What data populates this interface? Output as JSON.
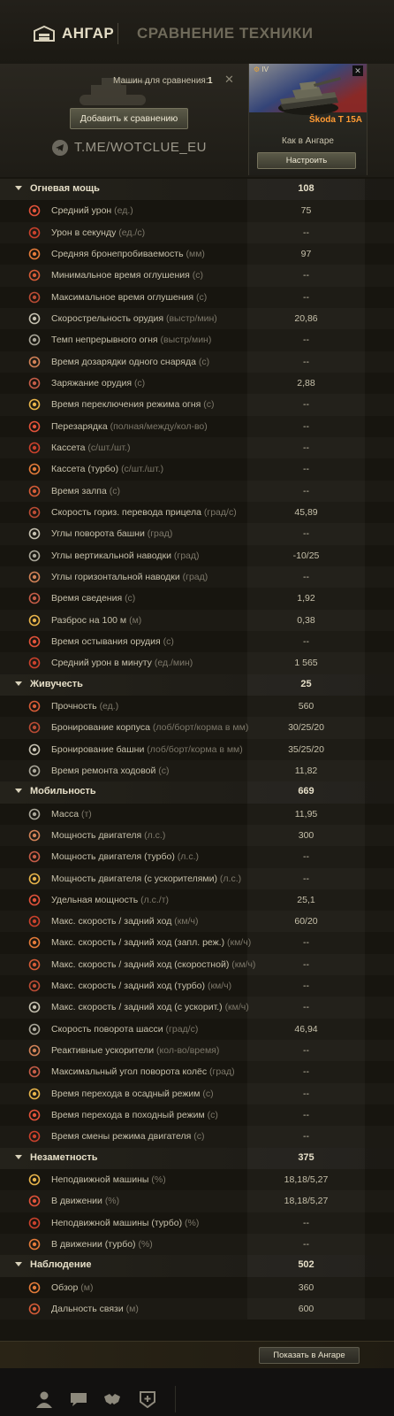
{
  "header": {
    "hangar": "АНГАР",
    "compare": "СРАВНЕНИЕ ТЕХНИКИ"
  },
  "panel": {
    "count_label": "Машин для сравнения:",
    "count_value": "1",
    "add_button": "Добавить к сравнению",
    "watermark": "T.ME/WOTCLUE_EU"
  },
  "vehicle": {
    "level": "IV",
    "name": "Škoda T 15A",
    "config": "Как в Ангаре",
    "configure_button": "Настроить"
  },
  "sections": [
    {
      "title": "Огневая мощь",
      "value": "108",
      "stats": [
        {
          "icon": "avg-damage-icon",
          "label": "Средний урон",
          "unit": "(ед.)",
          "value": "75"
        },
        {
          "icon": "damage-per-second-icon",
          "label": "Урон в секунду",
          "unit": "(ед./с)",
          "value": "--"
        },
        {
          "icon": "penetration-icon",
          "label": "Средняя бронепробиваемость",
          "unit": "(мм)",
          "value": "97"
        },
        {
          "icon": "min-stun-icon",
          "label": "Минимальное время оглушения",
          "unit": "(с)",
          "value": "--"
        },
        {
          "icon": "max-stun-icon",
          "label": "Максимальное время оглушения",
          "unit": "(с)",
          "value": "--"
        },
        {
          "icon": "rate-of-fire-icon",
          "label": "Скорострельность орудия",
          "unit": "(выстр/мин)",
          "value": "20,86"
        },
        {
          "icon": "continuous-fire-icon",
          "label": "Темп непрерывного огня",
          "unit": "(выстр/мин)",
          "value": "--"
        },
        {
          "icon": "shell-reload-icon",
          "label": "Время дозарядки одного снаряда",
          "unit": "(с)",
          "value": "--"
        },
        {
          "icon": "reload-icon",
          "label": "Заряжание орудия",
          "unit": "(с)",
          "value": "2,88"
        },
        {
          "icon": "fire-mode-switch-icon",
          "label": "Время переключения режима огня",
          "unit": "(с)",
          "value": "--"
        },
        {
          "icon": "autoreload-icon",
          "label": "Перезарядка",
          "unit": "(полная/между/кол-во)",
          "value": "--"
        },
        {
          "icon": "clip-icon",
          "label": "Кассета",
          "unit": "(с/шт./шт.)",
          "value": "--"
        },
        {
          "icon": "clip-turbo-icon",
          "label": "Кассета (турбо)",
          "unit": "(с/шт./шт.)",
          "value": "--"
        },
        {
          "icon": "salvo-icon",
          "label": "Время залпа",
          "unit": "(с)",
          "value": "--"
        },
        {
          "icon": "traverse-speed-icon",
          "label": "Скорость гориз. перевода прицела",
          "unit": "(град/с)",
          "value": "45,89"
        },
        {
          "icon": "turret-rotation-icon",
          "label": "Углы поворота башни",
          "unit": "(град)",
          "value": "--"
        },
        {
          "icon": "elevation-icon",
          "label": "Углы вертикальной наводки",
          "unit": "(град)",
          "value": "-10/25"
        },
        {
          "icon": "horizontal-aim-icon",
          "label": "Углы горизонтальной наводки",
          "unit": "(град)",
          "value": "--"
        },
        {
          "icon": "aim-time-icon",
          "label": "Время сведения",
          "unit": "(с)",
          "value": "1,92"
        },
        {
          "icon": "dispersion-icon",
          "label": "Разброс на 100 м",
          "unit": "(м)",
          "value": "0,38"
        },
        {
          "icon": "cooldown-icon",
          "label": "Время остывания орудия",
          "unit": "(с)",
          "value": "--"
        },
        {
          "icon": "damage-per-minute-icon",
          "label": "Средний урон в минуту",
          "unit": "(ед./мин)",
          "value": "1 565"
        }
      ]
    },
    {
      "title": "Живучесть",
      "value": "25",
      "stats": [
        {
          "icon": "hit-points-icon",
          "label": "Прочность",
          "unit": "(ед.)",
          "value": "560"
        },
        {
          "icon": "hull-armor-icon",
          "label": "Бронирование корпуса",
          "unit": "(лоб/борт/корма в мм)",
          "value": "30/25/20"
        },
        {
          "icon": "turret-armor-icon",
          "label": "Бронирование башни",
          "unit": "(лоб/борт/корма в мм)",
          "value": "35/25/20"
        },
        {
          "icon": "track-repair-icon",
          "label": "Время ремонта ходовой",
          "unit": "(с)",
          "value": "11,82"
        }
      ]
    },
    {
      "title": "Мобильность",
      "value": "669",
      "stats": [
        {
          "icon": "weight-icon",
          "label": "Масса",
          "unit": "(т)",
          "value": "11,95"
        },
        {
          "icon": "engine-power-icon",
          "label": "Мощность двигателя",
          "unit": "(л.с.)",
          "value": "300"
        },
        {
          "icon": "engine-turbo-icon",
          "label": "Мощность двигателя (турбо)",
          "unit": "(л.с.)",
          "value": "--"
        },
        {
          "icon": "engine-boost-icon",
          "label": "Мощность двигателя (с ускорителями)",
          "unit": "(л.с.)",
          "value": "--"
        },
        {
          "icon": "specific-power-icon",
          "label": "Удельная мощность",
          "unit": "(л.с./т)",
          "value": "25,1"
        },
        {
          "icon": "speed-icon",
          "label": "Макс. скорость / задний ход",
          "unit": "(км/ч)",
          "value": "60/20"
        },
        {
          "icon": "speed-reserve-icon",
          "label": "Макс. скорость / задний ход (запл. реж.)",
          "unit": "(км/ч)",
          "value": "--"
        },
        {
          "icon": "speed-fast-icon",
          "label": "Макс. скорость / задний ход (скоростной)",
          "unit": "(км/ч)",
          "value": "--"
        },
        {
          "icon": "speed-turbo-icon",
          "label": "Макс. скорость / задний ход (турбо)",
          "unit": "(км/ч)",
          "value": "--"
        },
        {
          "icon": "speed-boost-icon",
          "label": "Макс. скорость / задний ход (с ускорит.)",
          "unit": "(км/ч)",
          "value": "--"
        },
        {
          "icon": "hull-traverse-icon",
          "label": "Скорость поворота шасси",
          "unit": "(град/с)",
          "value": "46,94"
        },
        {
          "icon": "rocket-booster-icon",
          "label": "Реактивные ускорители",
          "unit": "(кол-во/время)",
          "value": "--"
        },
        {
          "icon": "wheel-angle-icon",
          "label": "Максимальный угол поворота колёс",
          "unit": "(град)",
          "value": "--"
        },
        {
          "icon": "siege-mode-icon",
          "label": "Время перехода в осадный режим",
          "unit": "(с)",
          "value": "--"
        },
        {
          "icon": "travel-mode-icon",
          "label": "Время перехода в походный режим",
          "unit": "(с)",
          "value": "--"
        },
        {
          "icon": "engine-mode-icon",
          "label": "Время смены режима двигателя",
          "unit": "(с)",
          "value": "--"
        }
      ]
    },
    {
      "title": "Незаметность",
      "value": "375",
      "stats": [
        {
          "icon": "stationary-camo-icon",
          "label": "Неподвижной машины",
          "unit": "(%)",
          "value": "18,18/5,27"
        },
        {
          "icon": "moving-camo-icon",
          "label": "В движении",
          "unit": "(%)",
          "value": "18,18/5,27"
        },
        {
          "icon": "stationary-camo-turbo-icon",
          "label": "Неподвижной машины (турбо)",
          "unit": "(%)",
          "value": "--"
        },
        {
          "icon": "moving-camo-turbo-icon",
          "label": "В движении (турбо)",
          "unit": "(%)",
          "value": "--"
        }
      ]
    },
    {
      "title": "Наблюдение",
      "value": "502",
      "stats": [
        {
          "icon": "view-range-icon",
          "label": "Обзор",
          "unit": "(м)",
          "value": "360"
        },
        {
          "icon": "radio-range-icon",
          "label": "Дальность связи",
          "unit": "(м)",
          "value": "600"
        }
      ]
    }
  ],
  "footer": {
    "show_button": "Показать в Ангаре"
  },
  "taskbar": [
    "profile-icon",
    "chat-icon",
    "clan-icon",
    "missions-icon"
  ]
}
